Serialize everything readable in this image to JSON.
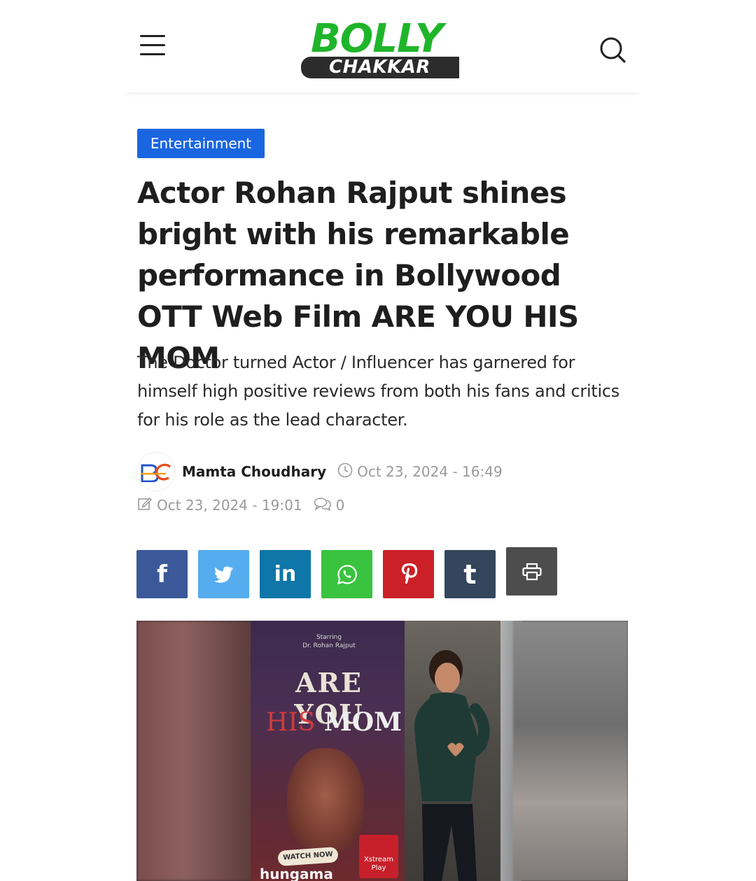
{
  "header": {
    "logo_top": "BOLLY",
    "logo_bottom": "CHAKKAR",
    "brand_green": "#1fb52a",
    "menu_icon": "hamburger-menu-icon",
    "search_icon": "search-icon"
  },
  "article": {
    "category": "Entertainment",
    "category_color": "#1a66e0",
    "title": "Actor Rohan Rajput shines bright with his remarkable performance in Bollywood OTT Web Film ARE YOU HIS MOM",
    "subtitle": "The Doctor turned Actor / Influencer has garnered for himself high positive reviews from both  his fans and critics for his role as  the lead character.",
    "author": "Mamta Choudhary",
    "avatar_text": "BC",
    "published": "Oct 23, 2024 - 16:49",
    "updated": "Oct 23, 2024 - 19:01",
    "comments": "0"
  },
  "share": [
    {
      "name": "facebook",
      "icon": "facebook-icon",
      "label": "f",
      "color": "#3b5998"
    },
    {
      "name": "twitter",
      "icon": "twitter-icon",
      "label": "",
      "color": "#55acee"
    },
    {
      "name": "linkedin",
      "icon": "linkedin-icon",
      "label": "in",
      "color": "#0e76a8"
    },
    {
      "name": "whatsapp",
      "icon": "whatsapp-icon",
      "label": "",
      "color": "#3ac33e"
    },
    {
      "name": "pinterest",
      "icon": "pinterest-icon",
      "label": "",
      "color": "#cb2027"
    },
    {
      "name": "tumblr",
      "icon": "tumblr-icon",
      "label": "t",
      "color": "#35465c"
    },
    {
      "name": "print",
      "icon": "print-icon",
      "label": "",
      "color": "#4d4d4d"
    }
  ],
  "hero": {
    "starring_line1": "Starring",
    "starring_line2": "Dr. Rohan Rajput",
    "poster_title_1": "ARE YOU",
    "poster_title_his": "HIS",
    "poster_title_mom": "MOM",
    "watch_now": "WATCH NOW",
    "hungama": "hungama",
    "xstream_1": "Xstream",
    "xstream_2": "Play"
  }
}
